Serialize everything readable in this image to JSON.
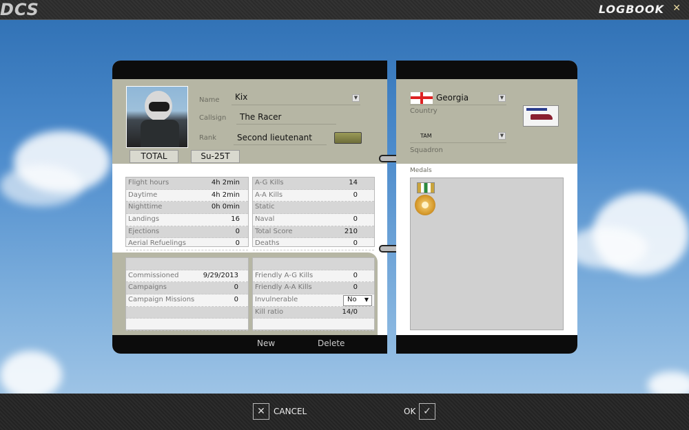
{
  "window": {
    "title": "LOGBOOK",
    "logo": "DCS",
    "close_icon": "close-icon"
  },
  "profile": {
    "name_label": "Name",
    "name_value": "Kix",
    "callsign_label": "Callsign",
    "callsign_value": "The Racer",
    "rank_label": "Rank",
    "rank_value": "Second lieutenant"
  },
  "tabs": [
    "TOTAL",
    "Su-25T"
  ],
  "right": {
    "country_value": "Georgia",
    "country_label": "Country",
    "squadron_value": "TAM",
    "squadron_label": "Squadron",
    "medals_label": "Medals"
  },
  "stats_left": [
    {
      "label": "Flight hours",
      "value": "4h 2min"
    },
    {
      "label": "Daytime",
      "value": "4h 2min"
    },
    {
      "label": "Nighttime",
      "value": "0h 0min"
    },
    {
      "label": "Landings",
      "value": "16"
    },
    {
      "label": "Ejections",
      "value": "0"
    },
    {
      "label": "Aerial Refuelings",
      "value": "0"
    }
  ],
  "stats_right": [
    {
      "label": "A-G Kills",
      "value": "14"
    },
    {
      "label": "A-A Kills",
      "value": "0"
    },
    {
      "label": "Static",
      "value": ""
    },
    {
      "label": "Naval",
      "value": "0"
    },
    {
      "label": "Total Score",
      "value": "210"
    },
    {
      "label": "Deaths",
      "value": "0"
    }
  ],
  "career_left": [
    {
      "label": "",
      "value": ""
    },
    {
      "label": "Commissioned",
      "value": "9/29/2013"
    },
    {
      "label": "Campaigns",
      "value": "0"
    },
    {
      "label": "Campaign Missions",
      "value": "0"
    },
    {
      "label": "",
      "value": ""
    },
    {
      "label": "",
      "value": ""
    }
  ],
  "career_right": [
    {
      "label": "",
      "value": ""
    },
    {
      "label": "Friendly A-G Kills",
      "value": "0"
    },
    {
      "label": "Friendly A-A Kills",
      "value": "0"
    },
    {
      "label": "Invulnerable",
      "value": "No"
    },
    {
      "label": "Kill ratio",
      "value": "14/0"
    },
    {
      "label": "",
      "value": ""
    }
  ],
  "actions": {
    "new": "New",
    "delete": "Delete"
  },
  "footer": {
    "cancel": "CANCEL",
    "ok": "OK"
  }
}
